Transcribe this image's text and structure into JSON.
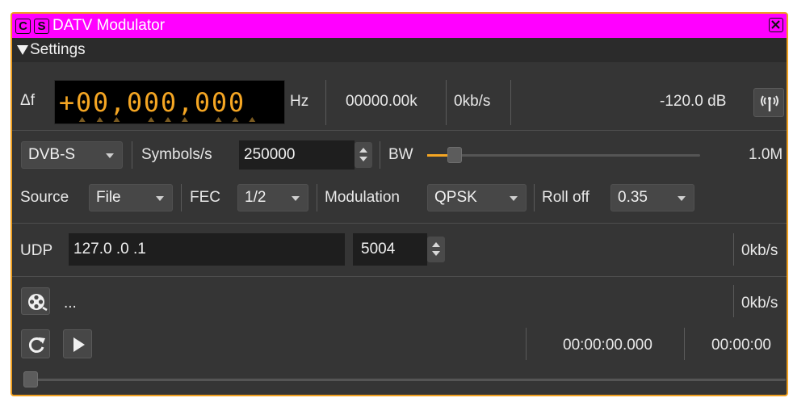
{
  "window": {
    "title_badges": [
      "C",
      "S"
    ],
    "title": "DATV Modulator",
    "close_icon": "close-icon",
    "colors": {
      "titlebar": "#ff00ff",
      "border": "#f0a020",
      "accent": "#f5a623"
    }
  },
  "settings_header": {
    "label": "Settings",
    "icon": "triangle-down-icon"
  },
  "frequency": {
    "delta_label": "Δf",
    "digits": [
      "+",
      "0",
      "0",
      ",",
      "0",
      "0",
      "0",
      ",",
      "0",
      "0",
      "0"
    ],
    "unit": "Hz",
    "channel_rate": "00000.00k",
    "bitrate": "0kb/s",
    "power": "-120.0 dB",
    "antenna_icon": "antenna-icon"
  },
  "modulation_row": {
    "standard": "DVB-S",
    "symbols_label": "Symbols/s",
    "symbols_value": "250000",
    "bw_label": "BW",
    "bw_slider_level": 0.08,
    "bw_value": "1.0M"
  },
  "options_row": {
    "source_label": "Source",
    "source_value": "File",
    "fec_label": "FEC",
    "fec_value": "1/2",
    "modulation_label": "Modulation",
    "modulation_value": "QPSK",
    "rolloff_label": "Roll off",
    "rolloff_value": "0.35"
  },
  "udp": {
    "label": "UDP",
    "address": "127.0 .0 .1",
    "port": "5004",
    "rate": "0kb/s"
  },
  "file": {
    "open_icon": "film-reel-icon",
    "filename": "...",
    "rate": "0kb/s"
  },
  "playback": {
    "loop_icon": "loop-icon",
    "play_icon": "play-icon",
    "elapsed": "00:00:00.000",
    "total": "00:00:00",
    "position_level": 0.0
  }
}
